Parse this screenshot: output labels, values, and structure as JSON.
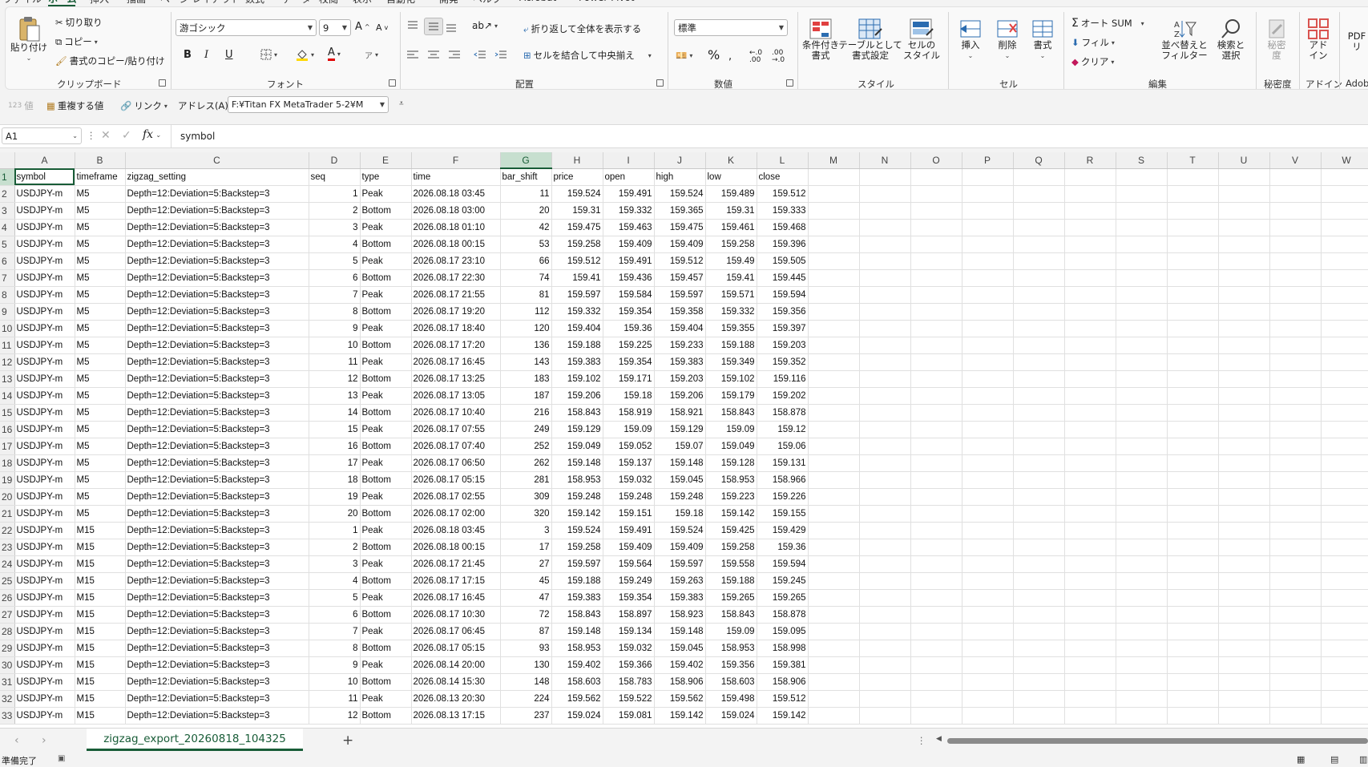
{
  "menu": {
    "tabs": [
      "ファイル",
      "ホーム",
      "挿入",
      "描画",
      "ページ レイアウト",
      "数式",
      "データ",
      "校閲",
      "表示",
      "自動化",
      "開発",
      "ヘルプ",
      "Acrobat",
      "Power Pivot"
    ],
    "active": "ホーム"
  },
  "ribbon": {
    "clipboard": {
      "paste": "貼り付け",
      "cut": "切り取り",
      "copy": "コピー",
      "format_painter": "書式のコピー/貼り付け",
      "label": "クリップボード"
    },
    "font": {
      "name": "游ゴシック",
      "size": "9",
      "bold": "B",
      "italic": "I",
      "underline": "U",
      "label": "フォント"
    },
    "alignment": {
      "wrap": "折り返して全体を表示する",
      "merge": "セルを結合して中央揃え",
      "label": "配置"
    },
    "number": {
      "format": "標準",
      "percent": "%",
      "label": "数値"
    },
    "styles": {
      "conditional": "条件付き\n書式",
      "table": "テーブルとして\n書式設定",
      "cell_style": "セルの\nスタイル",
      "label": "スタイル"
    },
    "cells": {
      "insert": "挿入",
      "delete": "削除",
      "format": "書式",
      "label": "セル"
    },
    "editing": {
      "autosum": "オート SUM",
      "fill": "フィル",
      "clear": "クリア",
      "sort": "並べ替えと\nフィルター",
      "find": "検索と\n選択",
      "label": "編集"
    },
    "sensitivity": {
      "button": "秘密\n度",
      "label": "秘密度"
    },
    "addins": {
      "button": "アド\nイン",
      "label": "アドイン"
    },
    "pdf": {
      "button": "PDF\nリ",
      "label": "Adob"
    }
  },
  "quickbar": {
    "value_label": "値",
    "duplicate": "重複する値",
    "link": "リンク",
    "address_label": "アドレス(A):",
    "address_value": "F:¥Titan FX MetaTrader 5-2¥M"
  },
  "formula": {
    "name_box": "A1",
    "fx": "fx",
    "content": "symbol"
  },
  "sheet": {
    "columns": [
      "A",
      "B",
      "C",
      "D",
      "E",
      "F",
      "G",
      "H",
      "I",
      "J",
      "K",
      "L",
      "M",
      "N",
      "O",
      "P",
      "Q",
      "R",
      "S",
      "T",
      "U",
      "V",
      "W"
    ],
    "selected_column": "G",
    "header": [
      "symbol",
      "timeframe",
      "zigzag_setting",
      "seq",
      "type",
      "time",
      "bar_shift",
      "price",
      "open",
      "high",
      "low",
      "close"
    ],
    "rows": [
      [
        "USDJPY-m",
        "M5",
        "Depth=12:Deviation=5:Backstep=3",
        "1",
        "Peak",
        "2026.08.18 03:45",
        "11",
        "159.524",
        "159.491",
        "159.524",
        "159.489",
        "159.512"
      ],
      [
        "USDJPY-m",
        "M5",
        "Depth=12:Deviation=5:Backstep=3",
        "2",
        "Bottom",
        "2026.08.18 03:00",
        "20",
        "159.31",
        "159.332",
        "159.365",
        "159.31",
        "159.333"
      ],
      [
        "USDJPY-m",
        "M5",
        "Depth=12:Deviation=5:Backstep=3",
        "3",
        "Peak",
        "2026.08.18 01:10",
        "42",
        "159.475",
        "159.463",
        "159.475",
        "159.461",
        "159.468"
      ],
      [
        "USDJPY-m",
        "M5",
        "Depth=12:Deviation=5:Backstep=3",
        "4",
        "Bottom",
        "2026.08.18 00:15",
        "53",
        "159.258",
        "159.409",
        "159.409",
        "159.258",
        "159.396"
      ],
      [
        "USDJPY-m",
        "M5",
        "Depth=12:Deviation=5:Backstep=3",
        "5",
        "Peak",
        "2026.08.17 23:10",
        "66",
        "159.512",
        "159.491",
        "159.512",
        "159.49",
        "159.505"
      ],
      [
        "USDJPY-m",
        "M5",
        "Depth=12:Deviation=5:Backstep=3",
        "6",
        "Bottom",
        "2026.08.17 22:30",
        "74",
        "159.41",
        "159.436",
        "159.457",
        "159.41",
        "159.445"
      ],
      [
        "USDJPY-m",
        "M5",
        "Depth=12:Deviation=5:Backstep=3",
        "7",
        "Peak",
        "2026.08.17 21:55",
        "81",
        "159.597",
        "159.584",
        "159.597",
        "159.571",
        "159.594"
      ],
      [
        "USDJPY-m",
        "M5",
        "Depth=12:Deviation=5:Backstep=3",
        "8",
        "Bottom",
        "2026.08.17 19:20",
        "112",
        "159.332",
        "159.354",
        "159.358",
        "159.332",
        "159.356"
      ],
      [
        "USDJPY-m",
        "M5",
        "Depth=12:Deviation=5:Backstep=3",
        "9",
        "Peak",
        "2026.08.17 18:40",
        "120",
        "159.404",
        "159.36",
        "159.404",
        "159.355",
        "159.397"
      ],
      [
        "USDJPY-m",
        "M5",
        "Depth=12:Deviation=5:Backstep=3",
        "10",
        "Bottom",
        "2026.08.17 17:20",
        "136",
        "159.188",
        "159.225",
        "159.233",
        "159.188",
        "159.203"
      ],
      [
        "USDJPY-m",
        "M5",
        "Depth=12:Deviation=5:Backstep=3",
        "11",
        "Peak",
        "2026.08.17 16:45",
        "143",
        "159.383",
        "159.354",
        "159.383",
        "159.349",
        "159.352"
      ],
      [
        "USDJPY-m",
        "M5",
        "Depth=12:Deviation=5:Backstep=3",
        "12",
        "Bottom",
        "2026.08.17 13:25",
        "183",
        "159.102",
        "159.171",
        "159.203",
        "159.102",
        "159.116"
      ],
      [
        "USDJPY-m",
        "M5",
        "Depth=12:Deviation=5:Backstep=3",
        "13",
        "Peak",
        "2026.08.17 13:05",
        "187",
        "159.206",
        "159.18",
        "159.206",
        "159.179",
        "159.202"
      ],
      [
        "USDJPY-m",
        "M5",
        "Depth=12:Deviation=5:Backstep=3",
        "14",
        "Bottom",
        "2026.08.17 10:40",
        "216",
        "158.843",
        "158.919",
        "158.921",
        "158.843",
        "158.878"
      ],
      [
        "USDJPY-m",
        "M5",
        "Depth=12:Deviation=5:Backstep=3",
        "15",
        "Peak",
        "2026.08.17 07:55",
        "249",
        "159.129",
        "159.09",
        "159.129",
        "159.09",
        "159.12"
      ],
      [
        "USDJPY-m",
        "M5",
        "Depth=12:Deviation=5:Backstep=3",
        "16",
        "Bottom",
        "2026.08.17 07:40",
        "252",
        "159.049",
        "159.052",
        "159.07",
        "159.049",
        "159.06"
      ],
      [
        "USDJPY-m",
        "M5",
        "Depth=12:Deviation=5:Backstep=3",
        "17",
        "Peak",
        "2026.08.17 06:50",
        "262",
        "159.148",
        "159.137",
        "159.148",
        "159.128",
        "159.131"
      ],
      [
        "USDJPY-m",
        "M5",
        "Depth=12:Deviation=5:Backstep=3",
        "18",
        "Bottom",
        "2026.08.17 05:15",
        "281",
        "158.953",
        "159.032",
        "159.045",
        "158.953",
        "158.966"
      ],
      [
        "USDJPY-m",
        "M5",
        "Depth=12:Deviation=5:Backstep=3",
        "19",
        "Peak",
        "2026.08.17 02:55",
        "309",
        "159.248",
        "159.248",
        "159.248",
        "159.223",
        "159.226"
      ],
      [
        "USDJPY-m",
        "M5",
        "Depth=12:Deviation=5:Backstep=3",
        "20",
        "Bottom",
        "2026.08.17 02:00",
        "320",
        "159.142",
        "159.151",
        "159.18",
        "159.142",
        "159.155"
      ],
      [
        "USDJPY-m",
        "M15",
        "Depth=12:Deviation=5:Backstep=3",
        "1",
        "Peak",
        "2026.08.18 03:45",
        "3",
        "159.524",
        "159.491",
        "159.524",
        "159.425",
        "159.429"
      ],
      [
        "USDJPY-m",
        "M15",
        "Depth=12:Deviation=5:Backstep=3",
        "2",
        "Bottom",
        "2026.08.18 00:15",
        "17",
        "159.258",
        "159.409",
        "159.409",
        "159.258",
        "159.36"
      ],
      [
        "USDJPY-m",
        "M15",
        "Depth=12:Deviation=5:Backstep=3",
        "3",
        "Peak",
        "2026.08.17 21:45",
        "27",
        "159.597",
        "159.564",
        "159.597",
        "159.558",
        "159.594"
      ],
      [
        "USDJPY-m",
        "M15",
        "Depth=12:Deviation=5:Backstep=3",
        "4",
        "Bottom",
        "2026.08.17 17:15",
        "45",
        "159.188",
        "159.249",
        "159.263",
        "159.188",
        "159.245"
      ],
      [
        "USDJPY-m",
        "M15",
        "Depth=12:Deviation=5:Backstep=3",
        "5",
        "Peak",
        "2026.08.17 16:45",
        "47",
        "159.383",
        "159.354",
        "159.383",
        "159.265",
        "159.265"
      ],
      [
        "USDJPY-m",
        "M15",
        "Depth=12:Deviation=5:Backstep=3",
        "6",
        "Bottom",
        "2026.08.17 10:30",
        "72",
        "158.843",
        "158.897",
        "158.923",
        "158.843",
        "158.878"
      ],
      [
        "USDJPY-m",
        "M15",
        "Depth=12:Deviation=5:Backstep=3",
        "7",
        "Peak",
        "2026.08.17 06:45",
        "87",
        "159.148",
        "159.134",
        "159.148",
        "159.09",
        "159.095"
      ],
      [
        "USDJPY-m",
        "M15",
        "Depth=12:Deviation=5:Backstep=3",
        "8",
        "Bottom",
        "2026.08.17 05:15",
        "93",
        "158.953",
        "159.032",
        "159.045",
        "158.953",
        "158.998"
      ],
      [
        "USDJPY-m",
        "M15",
        "Depth=12:Deviation=5:Backstep=3",
        "9",
        "Peak",
        "2026.08.14 20:00",
        "130",
        "159.402",
        "159.366",
        "159.402",
        "159.356",
        "159.381"
      ],
      [
        "USDJPY-m",
        "M15",
        "Depth=12:Deviation=5:Backstep=3",
        "10",
        "Bottom",
        "2026.08.14 15:30",
        "148",
        "158.603",
        "158.783",
        "158.906",
        "158.603",
        "158.906"
      ],
      [
        "USDJPY-m",
        "M15",
        "Depth=12:Deviation=5:Backstep=3",
        "11",
        "Peak",
        "2026.08.13 20:30",
        "224",
        "159.562",
        "159.522",
        "159.562",
        "159.498",
        "159.512"
      ],
      [
        "USDJPY-m",
        "M15",
        "Depth=12:Deviation=5:Backstep=3",
        "12",
        "Bottom",
        "2026.08.13 17:15",
        "237",
        "159.024",
        "159.081",
        "159.142",
        "159.024",
        "159.142"
      ]
    ]
  },
  "sheet_tab": {
    "name": "zigzag_export_20260818_104325",
    "add": "+"
  },
  "status": {
    "text": "準備完了"
  },
  "colors": {
    "accent": "#185c37",
    "selected_header": "#c7dfcf"
  }
}
